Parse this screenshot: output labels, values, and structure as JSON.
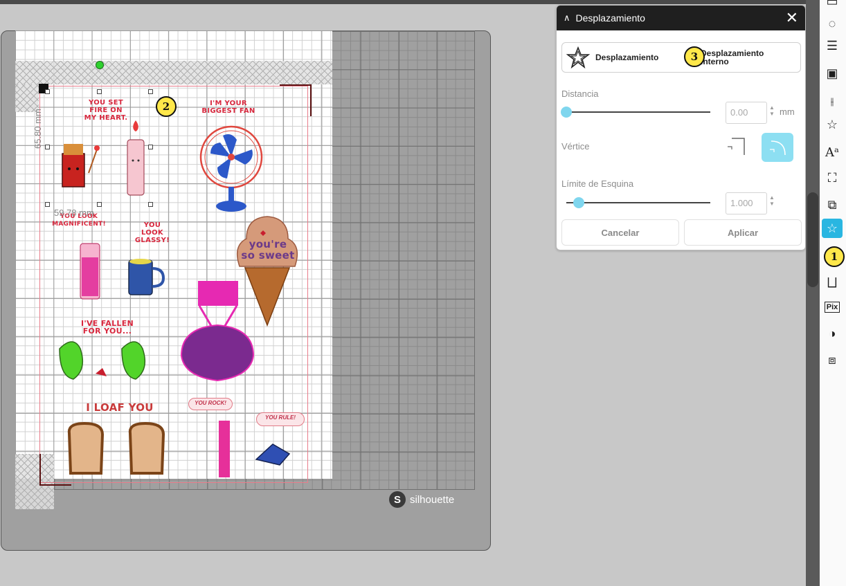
{
  "panel": {
    "title": "Desplazamiento",
    "mode_offset": "Desplazamiento",
    "mode_internal_line1": "Desplazamiento",
    "mode_internal_line2": "interno",
    "distance_label": "Distancia",
    "distance_value": "0.00",
    "distance_unit": "mm",
    "corner_label": "Vértice",
    "corner_selected": "round",
    "limit_label": "Límite de Esquina",
    "limit_value": "1.000",
    "cancel_label": "Cancelar",
    "apply_label": "Aplicar"
  },
  "canvas": {
    "brand": "silhouette",
    "width_dim": "59.78 mm",
    "height_dim": "65.80 mm"
  },
  "stickers": {
    "fire": "YOU SET\nFIRE ON\nMY HEART.",
    "fan": "I'M YOUR\nBIGGEST FAN",
    "magnificent": "YOU LOOK\nMAGNIFICENT!",
    "glassy": "YOU LOOK\nGLASSY!",
    "icecream": "you're so sweet",
    "fallen": "I'VE FALLEN\nFOR YOU...",
    "loaf": "I LOAF YOU",
    "rock": "YOU ROCK!",
    "rule": "YOU RULE!"
  },
  "badges": [
    "1",
    "2",
    "3"
  ],
  "colors": {
    "accent": "#29b6e1",
    "panel_header": "#1f1f1f",
    "badge": "#ffe84a"
  },
  "toolbar_icons": [
    "page-setup-icon",
    "color-palette-icon",
    "line-style-icon",
    "fill-pattern-icon",
    "align-icon",
    "replicate-icon",
    "text-style-icon",
    "transform-icon",
    "modify-icon",
    "offset-icon",
    "sketch-icon",
    "pixscan-icon",
    "trace-icon",
    "library-icon"
  ]
}
